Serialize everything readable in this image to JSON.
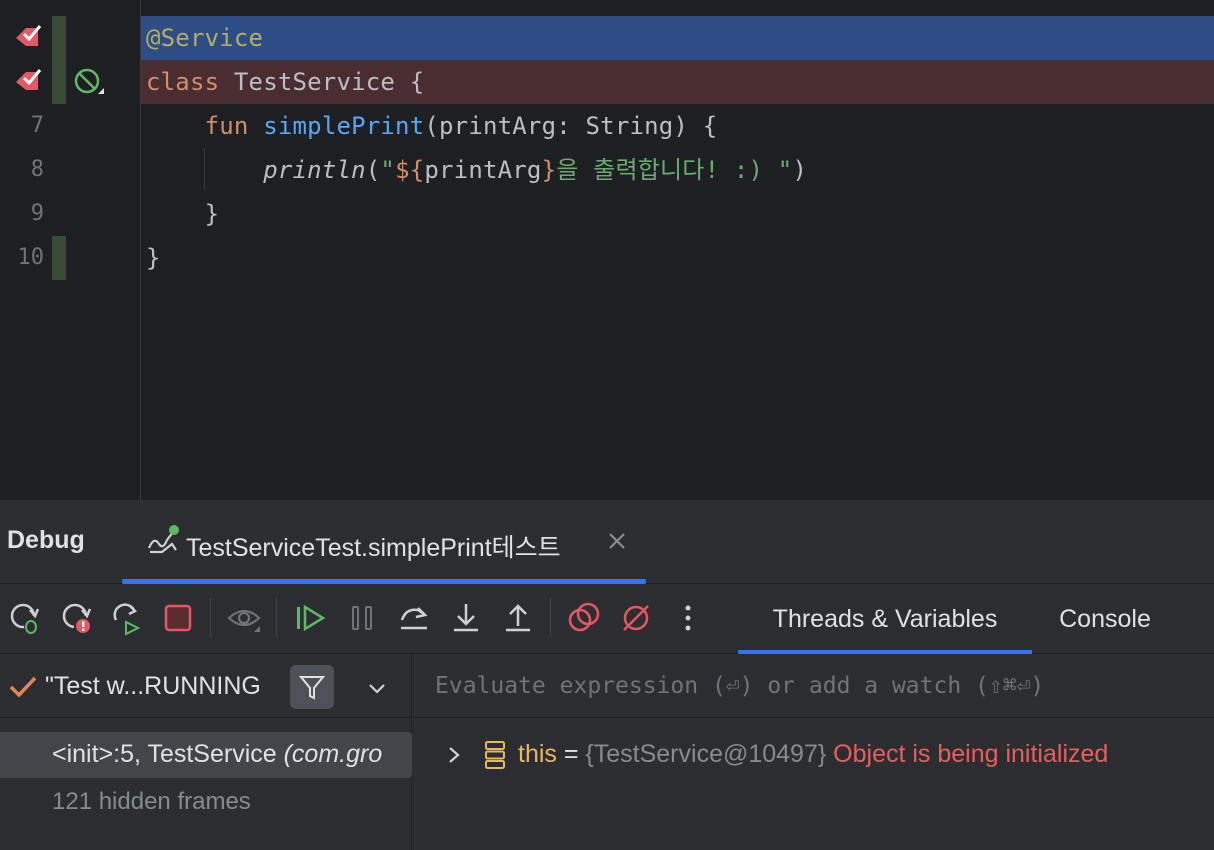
{
  "editor": {
    "lines": [
      {
        "num": "",
        "annotation": "@Service"
      },
      {
        "num": "",
        "kw_class": "class",
        "class_name": " TestService {"
      },
      {
        "num": "7",
        "kw_fun": "fun",
        "fn_name": "simplePrint",
        "signature": "(printArg: String) {"
      },
      {
        "num": "8",
        "call": "println",
        "open": "(",
        "q1": "\"",
        "tpl_open": "${",
        "tpl_var": "printArg",
        "tpl_close": "}",
        "str_rest": "을 출력합니다! :) \"",
        "close": ")"
      },
      {
        "num": "9",
        "code": "}"
      },
      {
        "num": "10",
        "code": "}"
      }
    ]
  },
  "debug": {
    "title": "Debug",
    "session_tab": "TestServiceTest.simplePrint테스트",
    "toolbar_icons": [
      "rerun-icon",
      "rerun-failed-icon",
      "restart-icon",
      "stop-icon",
      "view-icon",
      "resume-icon",
      "pause-icon",
      "step-over-icon",
      "step-into-icon",
      "step-out-icon",
      "view-breakpoints-icon",
      "mute-breakpoints-icon",
      "more-icon"
    ],
    "tabs": [
      {
        "label": "Threads & Variables",
        "active": true
      },
      {
        "label": "Console",
        "active": false
      }
    ],
    "thread": {
      "label": "\"Test w...RUNNING"
    },
    "frame": {
      "name": "<init>:5, TestService ",
      "pkg": "(com.gro"
    },
    "hidden_frames": "121 hidden frames",
    "evaluate": {
      "placeholder": "Evaluate expression (⏎) or add a watch (⇧⌘⏎)",
      "value": ""
    },
    "variable": {
      "name": "this",
      "eq": " = ",
      "value": "{TestService@10497}",
      "message": " Object is being initialized"
    }
  },
  "colors": {
    "accent": "#3574f0",
    "breakpoint": "#e55765",
    "line_highlight": "#2e4d86",
    "error_line": "#4a2d31"
  }
}
